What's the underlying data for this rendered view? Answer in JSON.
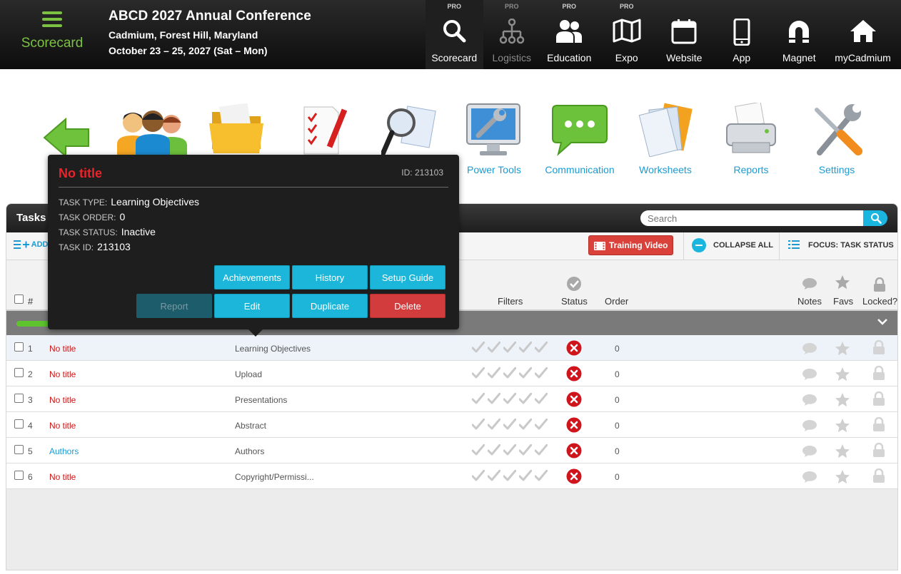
{
  "brand": {
    "label": "Scorecard"
  },
  "event": {
    "title": "ABCD 2027 Annual Conference",
    "location": "Cadmium, Forest Hill, Maryland",
    "dates": "October 23 – 25, 2027 (Sat – Mon)"
  },
  "nav": [
    {
      "label": "Scorecard",
      "pro": "PRO",
      "icon": "search-icon"
    },
    {
      "label": "Logistics",
      "pro": "PRO",
      "icon": "org-chart-icon"
    },
    {
      "label": "Education",
      "pro": "PRO",
      "icon": "people-icon"
    },
    {
      "label": "Expo",
      "pro": "PRO",
      "icon": "map-icon"
    },
    {
      "label": "Website",
      "pro": "",
      "icon": "calendar-icon"
    },
    {
      "label": "App",
      "pro": "",
      "icon": "phone-icon"
    },
    {
      "label": "Magnet",
      "pro": "",
      "icon": "magnet-icon"
    },
    {
      "label": "myCadmium",
      "pro": "",
      "icon": "home-icon"
    }
  ],
  "tools": [
    {
      "label": "Power Tools",
      "icon": "monitor-wrench-icon"
    },
    {
      "label": "Communication",
      "icon": "chat-bubble-icon"
    },
    {
      "label": "Worksheets",
      "icon": "documents-icon"
    },
    {
      "label": "Reports",
      "icon": "printer-icon"
    },
    {
      "label": "Settings",
      "icon": "tools-icon"
    }
  ],
  "tasks": {
    "title": "Tasks",
    "search_placeholder": "Search",
    "add_label": "ADD",
    "training_video": "Training Video",
    "collapse_all": "COLLAPSE ALL",
    "focus": "FOCUS: TASK STATUS",
    "columns": {
      "num": "#",
      "filters": "Filters",
      "status": "Status",
      "order": "Order",
      "notes": "Notes",
      "favs": "Favs",
      "locked": "Locked?"
    },
    "rows": [
      {
        "num": "1",
        "title": "No title",
        "type": "Learning Objectives",
        "order": "0",
        "title_color": "red"
      },
      {
        "num": "2",
        "title": "No title",
        "type": "Upload",
        "order": "0",
        "title_color": "red"
      },
      {
        "num": "3",
        "title": "No title",
        "type": "Presentations",
        "order": "0",
        "title_color": "red"
      },
      {
        "num": "4",
        "title": "No title",
        "type": "Abstract",
        "order": "0",
        "title_color": "red"
      },
      {
        "num": "5",
        "title": "Authors",
        "type": "Authors",
        "order": "0",
        "title_color": "blue"
      },
      {
        "num": "6",
        "title": "No title",
        "type": "Copyright/Permissi...",
        "order": "0",
        "title_color": "red"
      }
    ]
  },
  "popup": {
    "title": "No title",
    "id_text": "ID: 213103",
    "task_type_key": "TASK TYPE:",
    "task_type": "Learning Objectives",
    "task_order_key": "TASK ORDER:",
    "task_order": "0",
    "task_status_key": "TASK STATUS:",
    "task_status": "Inactive",
    "task_id_key": "TASK ID:",
    "task_id": "213103",
    "buttons": {
      "achievements": "Achievements",
      "history": "History",
      "setup_guide": "Setup Guide",
      "report": "Report",
      "edit": "Edit",
      "duplicate": "Duplicate",
      "delete": "Delete"
    }
  },
  "colors": {
    "accent": "#1bb6e0",
    "brand_green": "#7cc142",
    "danger": "#d33c3c"
  }
}
